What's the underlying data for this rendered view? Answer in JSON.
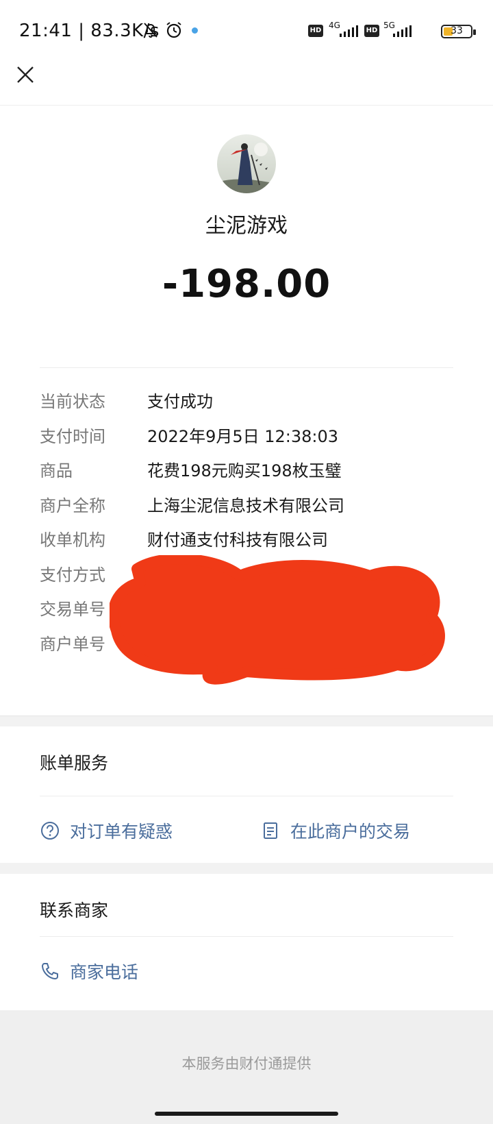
{
  "status_bar": {
    "time_speed": "21:41 | 83.3K/s",
    "hd1": "HD",
    "net1": "4G",
    "hd2": "HD",
    "net2": "5G",
    "battery": "33",
    "battery_level": 0.33
  },
  "merchant": {
    "name": "尘泥游戏",
    "amount": "-198.00"
  },
  "details": [
    {
      "label": "当前状态",
      "value": "支付成功"
    },
    {
      "label": "支付时间",
      "value": "2022年9月5日 12:38:03"
    },
    {
      "label": "商品",
      "value": "花费198元购买198枚玉璧"
    },
    {
      "label": "商户全称",
      "value": "上海尘泥信息技术有限公司"
    },
    {
      "label": "收单机构",
      "value": "财付通支付科技有限公司"
    },
    {
      "label": "支付方式",
      "value": ""
    },
    {
      "label": "交易单号",
      "value": ""
    },
    {
      "label": "商户单号",
      "value": ""
    }
  ],
  "bill_service": {
    "title": "账单服务",
    "question_order": "对订单有疑惑",
    "merchant_transactions": "在此商户的交易"
  },
  "contact": {
    "title": "联系商家",
    "phone": "商家电话"
  },
  "footer": {
    "text": "本服务由财付通提供"
  },
  "colors": {
    "accent": "#4a6d9c",
    "redaction": "#f03a17"
  }
}
